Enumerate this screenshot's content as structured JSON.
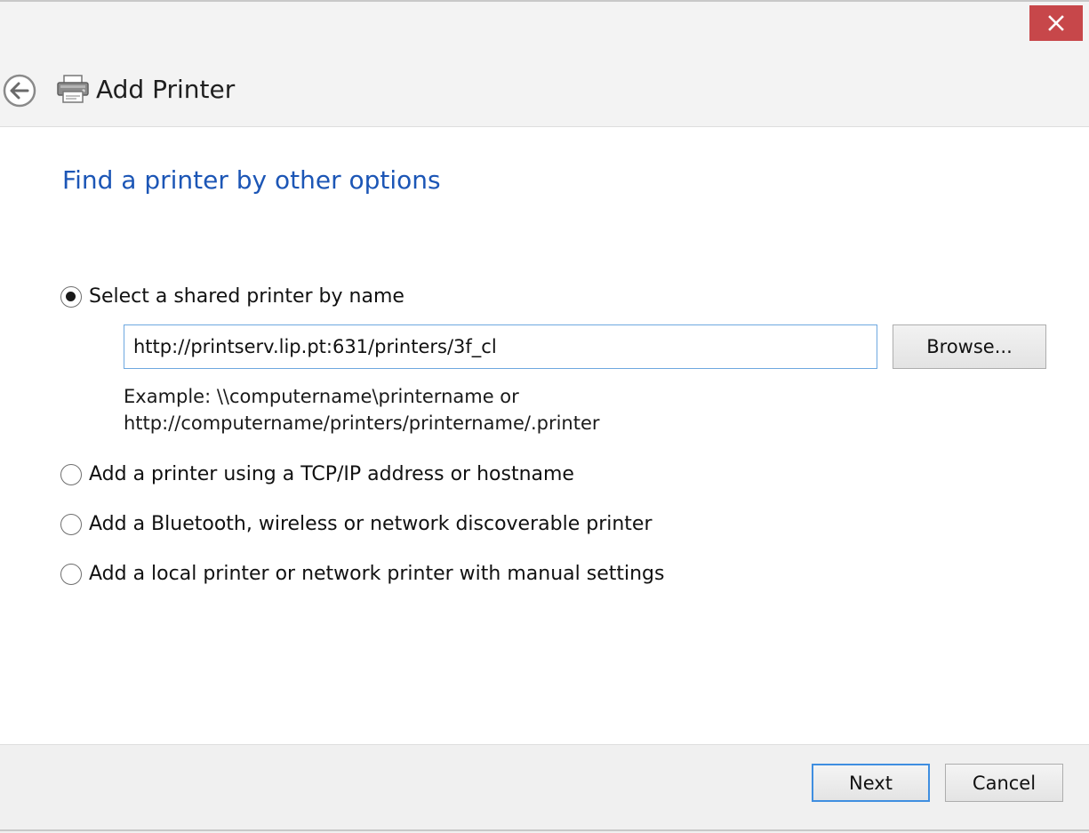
{
  "window": {
    "title": "Add Printer",
    "close_icon": "close-icon",
    "back_icon": "back-arrow-icon",
    "printer_icon": "printer-icon"
  },
  "page": {
    "heading": "Find a printer by other options"
  },
  "options": [
    {
      "label": "Select a shared printer by name",
      "selected": true
    },
    {
      "label": "Add a printer using a TCP/IP address or hostname",
      "selected": false
    },
    {
      "label": "Add a Bluetooth, wireless or network discoverable printer",
      "selected": false
    },
    {
      "label": "Add a local printer or network printer with manual settings",
      "selected": false
    }
  ],
  "shared_printer": {
    "value": "http://printserv.lip.pt:631/printers/3f_cl",
    "browse_label": "Browse...",
    "example_line1": "Example: \\\\computername\\printername or",
    "example_line2": "http://computername/printers/printername/.printer"
  },
  "footer": {
    "next_label": "Next",
    "cancel_label": "Cancel"
  },
  "colors": {
    "heading": "#1c56b6",
    "close_button": "#c7474a",
    "input_border": "#6ea8e0",
    "default_button_border": "#3f8ee0"
  }
}
